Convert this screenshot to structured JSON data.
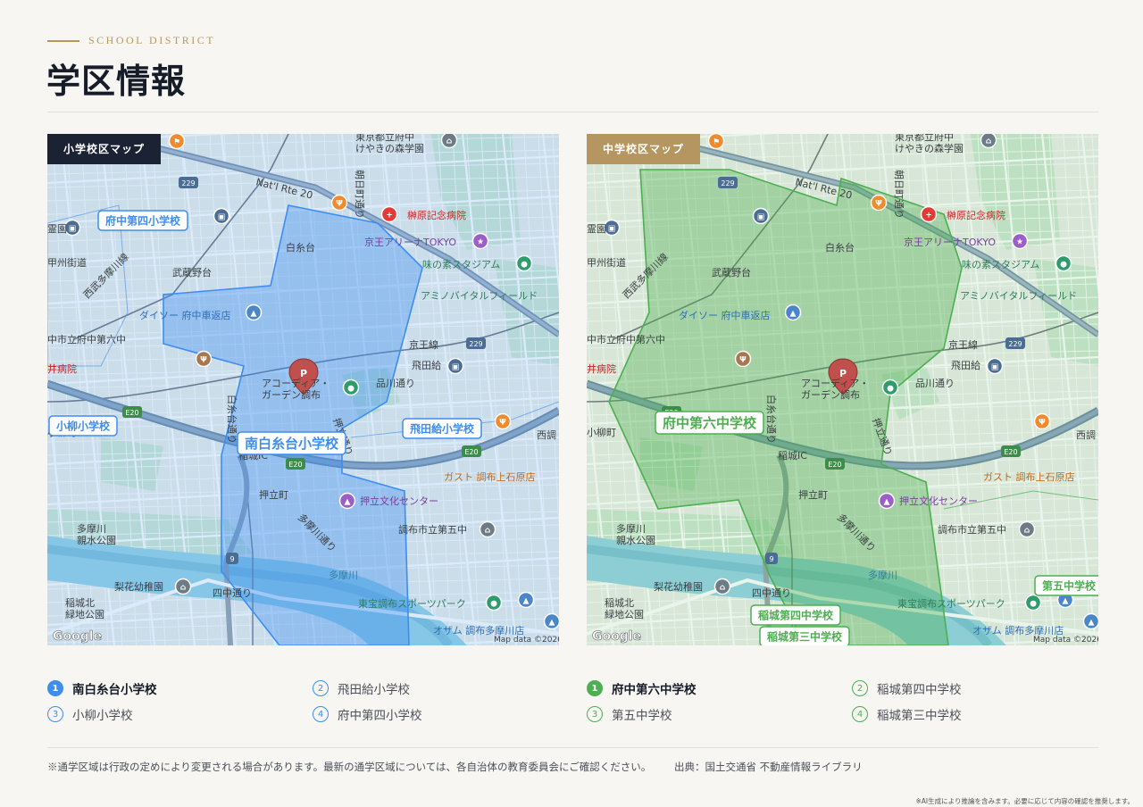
{
  "header": {
    "eyebrow": "SCHOOL DISTRICT",
    "title": "学区情報"
  },
  "maps": [
    {
      "tag": "小学校区マップ",
      "district_label": "南白糸台小学校",
      "school_labels": [
        "府中第四小学校",
        "小柳小学校",
        "飛田給小学校"
      ],
      "color": "#3d8ef0"
    },
    {
      "tag": "中学校区マップ",
      "district_label": "府中第六中学校",
      "school_labels": [
        "第五中学校",
        "稲城第四中学校",
        "稲城第三中学校"
      ],
      "color": "#4caf50"
    }
  ],
  "map_labels": {
    "hospital_top": "東京都立府中\nけやきの森学園",
    "sakakibara": "榊原記念病院",
    "arena": "京王アリーナTOKYO",
    "ajinomoto": "味の素スタジアム",
    "amino": "アミノバイタルフィールド",
    "shiraitodai": "白糸台",
    "musashinodai": "武蔵野台",
    "daiso": "ダイソー 府中車返店",
    "fuchu6": "中市立府中第六中",
    "byoin": "井病院",
    "tobitakyu": "飛田給",
    "keio": "京王線",
    "shinagawa": "品川通り",
    "acoltia": "アコーディア・\nガーデン調布",
    "koyagi": "小柳町",
    "inagi_ic": "稲城IC",
    "oshitate": "押立町",
    "oshitate_bunka": "押立文化センター",
    "gusto": "ガスト 調布上石原店",
    "chofu5": "調布市立第五中",
    "tamagawa_park": "多摩川\n親水公園",
    "tamagawa": "多摩川",
    "nashika": "梨花幼稚園",
    "inagikita": "稲城北\n緑地公園",
    "yonnochu": "四中通り",
    "toho": "東宝調布スポーツパーク",
    "ozamu": "オザム 調布多摩川店",
    "nisseicho": "西調",
    "natl": "Nat'l Rte 20",
    "r229": "229",
    "e20": "E20",
    "r9": "9",
    "google": "Google",
    "copyright": "Map data ©2026",
    "asahi": "朝日町通り",
    "shiraito_st": "白糸台通り",
    "oshitate_st": "押立通り",
    "tamagawa_st": "多摩川通り",
    "nishibu": "西武多摩川線",
    "konsen": "霊園",
    "koshi": "甲州街道"
  },
  "legend_elem": [
    {
      "num": "1",
      "name": "南白糸台小学校",
      "active": true
    },
    {
      "num": "2",
      "name": "飛田給小学校",
      "active": false
    },
    {
      "num": "3",
      "name": "小柳小学校",
      "active": false
    },
    {
      "num": "4",
      "name": "府中第四小学校",
      "active": false
    }
  ],
  "legend_mid": [
    {
      "num": "1",
      "name": "府中第六中学校",
      "active": true
    },
    {
      "num": "2",
      "name": "稲城第四中学校",
      "active": false
    },
    {
      "num": "3",
      "name": "第五中学校",
      "active": false
    },
    {
      "num": "4",
      "name": "稲城第三中学校",
      "active": false
    }
  ],
  "footer": {
    "note": "※通学区域は行政の定めにより変更される場合があります。最新の通学区域については、各自治体の教育委員会にご確認ください。",
    "source": "出典：国土交通省 不動産情報ライブラリ",
    "disclaimer": "※AI生成により推論を含みます。必要に応じて内容の確認を推奨します。"
  },
  "colors": {
    "accent_gold": "#b8975a",
    "elem_blue": "#3d8ef0",
    "mid_green": "#4caf50",
    "dark": "#1b2233"
  }
}
